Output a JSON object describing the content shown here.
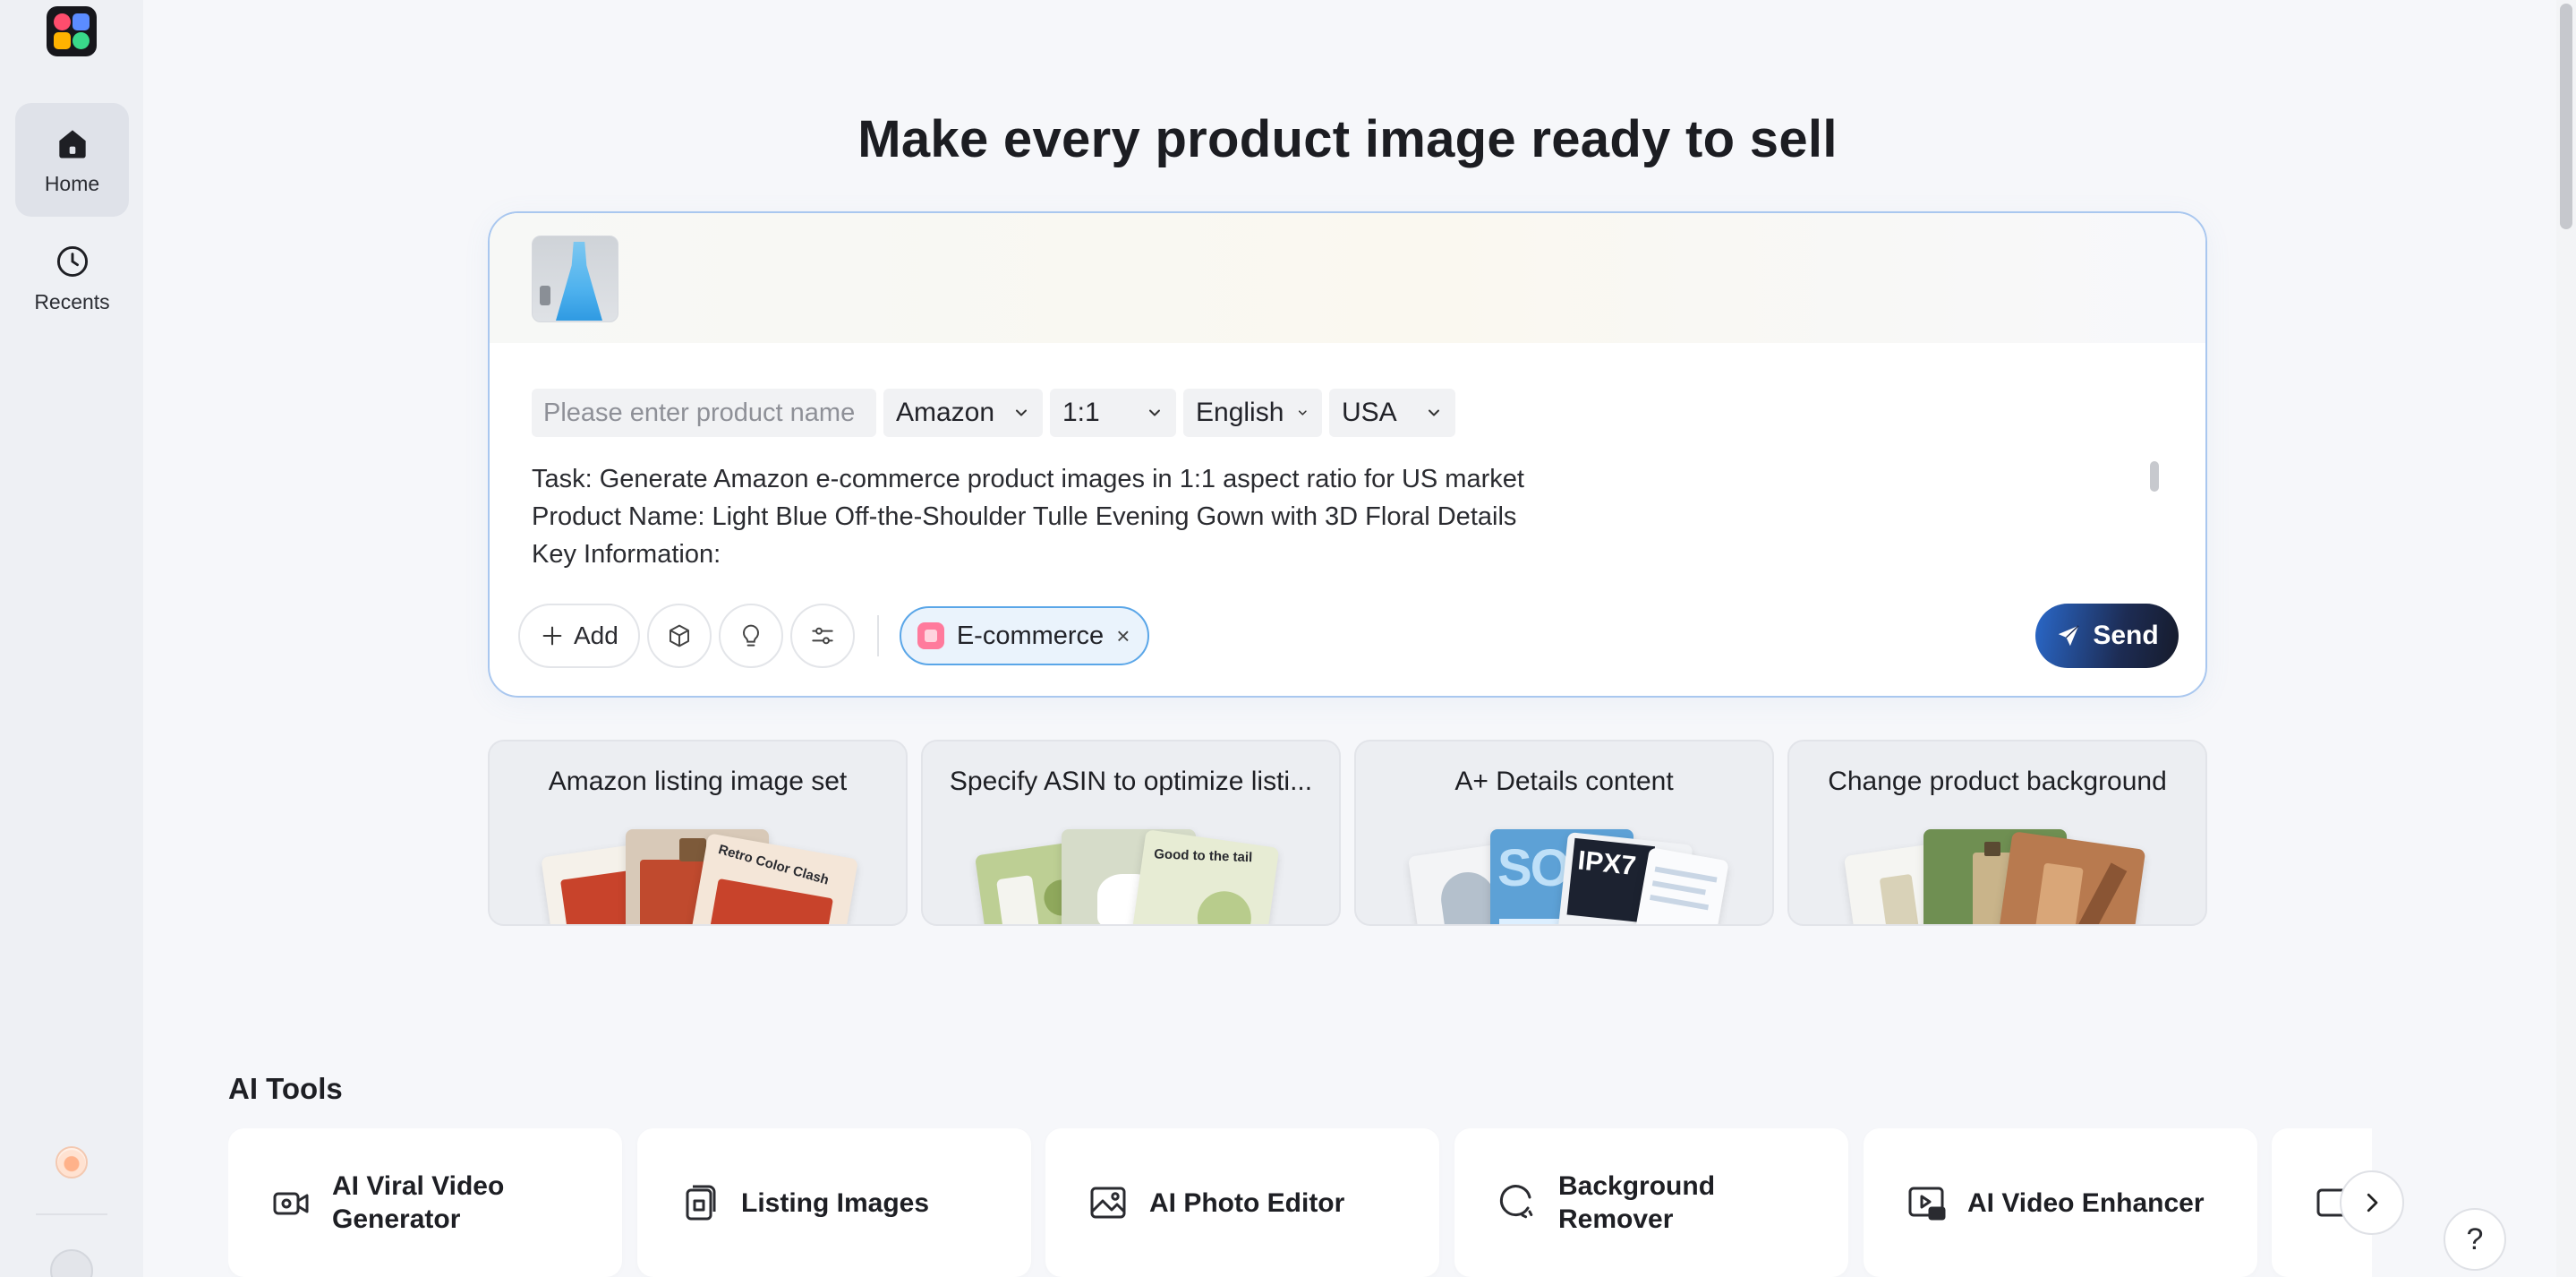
{
  "sidebar": {
    "items": [
      {
        "label": "Home",
        "icon": "home-icon",
        "active": true
      },
      {
        "label": "Recents",
        "icon": "clock-icon",
        "active": false
      }
    ]
  },
  "headline": "Make every product image ready to sell",
  "composer": {
    "product_name_placeholder": "Please enter product name",
    "platform": "Amazon",
    "ratio": "1:1",
    "language": "English",
    "region": "USA",
    "prompt": "Task: Generate Amazon e-commerce product images in 1:1 aspect ratio for US market\nProduct Name: Light Blue Off-the-Shoulder Tulle Evening Gown with 3D Floral Details\nKey Information:",
    "add_label": "Add",
    "tag_label": "E-commerce",
    "tag_close": "×",
    "send_label": "Send"
  },
  "templates": [
    {
      "title": "Amazon listing image set",
      "art_text": "Retro Color Clash"
    },
    {
      "title": "Specify ASIN to optimize listi...",
      "art_text": "Good to the tail"
    },
    {
      "title": "A+ Details content",
      "art_text": "IPX7"
    },
    {
      "title": "Change product background",
      "art_text": ""
    }
  ],
  "ai_tools": {
    "title": "AI Tools",
    "items": [
      {
        "label": "AI Viral Video Generator",
        "icon": "video-camera-icon"
      },
      {
        "label": "Listing Images",
        "icon": "listing-images-icon"
      },
      {
        "label": "AI Photo Editor",
        "icon": "photo-editor-icon"
      },
      {
        "label": "Background Remover",
        "icon": "background-remover-icon"
      },
      {
        "label": "AI Video Enhancer",
        "icon": "hd-video-icon"
      }
    ]
  },
  "help_label": "?",
  "colors": {
    "accent_blue": "#5aa6e8",
    "composer_border": "#a9c7ef",
    "send_dark": "#1d2c54",
    "tag_pink": "#ff7a9c"
  }
}
